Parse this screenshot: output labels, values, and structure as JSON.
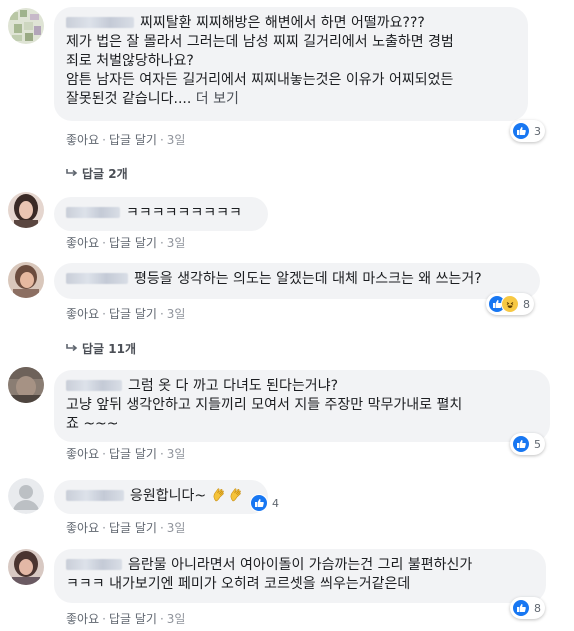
{
  "actions": {
    "like": "좋아요",
    "reply": "답글 달기"
  },
  "comments": [
    {
      "text_lines": [
        "찌찌탈환 찌찌해방은 해변에서 하면 어떨까요???",
        "제가 법은 잘 몰라서 그러는데 남성 찌찌 길거리에서 노출하면 경범",
        "죄로 처벌않당하나요?",
        "암튼 남자든 여자든 길거리에서 찌찌내놓는것은 이유가 어찌되었든",
        "잘못된것 같습니다...."
      ],
      "more": "더 보기",
      "time": "3일",
      "reactions": "3",
      "replies": "답글 2개"
    },
    {
      "text_lines": [
        "ㅋㅋㅋㅋㅋㅋㅋㅋㅋ"
      ],
      "time": "3일"
    },
    {
      "text_lines": [
        "평등을 생각하는 의도는 알겠는데 대체 마스크는 왜 쓰는거?"
      ],
      "time": "3일",
      "reactions": "8",
      "replies": "답글 11개"
    },
    {
      "text_lines": [
        "그럼 옷 다 까고 다녀도 된다는거냐?",
        "고냥 앞뒤 생각안하고 지들끼리 모여서 지들 주장만 막무가내로 펼치",
        "죠 ~~~"
      ],
      "time": "3일",
      "reactions": "5"
    },
    {
      "text_lines": [
        "응원합니다~"
      ],
      "time": "3일",
      "reactions": "4"
    },
    {
      "text_lines": [
        "음란물 아니라면서 여아이돌이 가슴까는건 그리 불편하신가",
        "ㅋㅋㅋ 내가보기엔 페미가 오히려 코르셋을 씌우는거같은데"
      ],
      "time": "3일",
      "reactions": "8"
    }
  ]
}
